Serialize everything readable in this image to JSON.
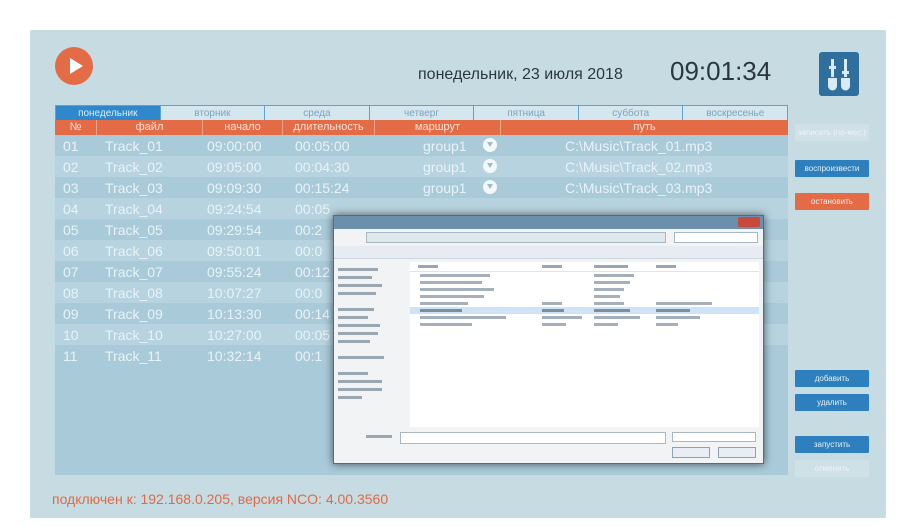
{
  "header": {
    "date": "понедельник, 23 июля 2018",
    "time": "09:01:34"
  },
  "tabs": [
    {
      "label": "понедельник",
      "active": true
    },
    {
      "label": "вторник",
      "active": false
    },
    {
      "label": "среда",
      "active": false
    },
    {
      "label": "четверг",
      "active": false
    },
    {
      "label": "пятница",
      "active": false
    },
    {
      "label": "суббота",
      "active": false
    },
    {
      "label": "воскресенье",
      "active": false
    }
  ],
  "table": {
    "columns": [
      "№",
      "файл",
      "начало",
      "длительность",
      "маршрут",
      "путь"
    ],
    "rows": [
      {
        "n": "01",
        "file": "Track_01",
        "start": "09:00:00",
        "dur": "00:05:00",
        "route": "group1",
        "path": "C:\\Music\\Track_01.mp3"
      },
      {
        "n": "02",
        "file": "Track_02",
        "start": "09:05:00",
        "dur": "00:04:30",
        "route": "group1",
        "path": "C:\\Music\\Track_02.mp3"
      },
      {
        "n": "03",
        "file": "Track_03",
        "start": "09:09:30",
        "dur": "00:15:24",
        "route": "group1",
        "path": "C:\\Music\\Track_03.mp3"
      },
      {
        "n": "04",
        "file": "Track_04",
        "start": "09:24:54",
        "dur": "00:05",
        "route": "",
        "path": ""
      },
      {
        "n": "05",
        "file": "Track_05",
        "start": "09:29:54",
        "dur": "00:2",
        "route": "",
        "path": ""
      },
      {
        "n": "06",
        "file": "Track_06",
        "start": "09:50:01",
        "dur": "00:0",
        "route": "",
        "path": ""
      },
      {
        "n": "07",
        "file": "Track_07",
        "start": "09:55:24",
        "dur": "00:12",
        "route": "",
        "path": ""
      },
      {
        "n": "08",
        "file": "Track_08",
        "start": "10:07:27",
        "dur": "00:0",
        "route": "",
        "path": ""
      },
      {
        "n": "09",
        "file": "Track_09",
        "start": "10:13:30",
        "dur": "00:14",
        "route": "",
        "path": ""
      },
      {
        "n": "10",
        "file": "Track_10",
        "start": "10:27:00",
        "dur": "00:05",
        "route": "",
        "path": ""
      },
      {
        "n": "11",
        "file": "Track_11",
        "start": "10:32:14",
        "dur": "00:1",
        "route": "",
        "path": ""
      }
    ]
  },
  "buttons": {
    "save": "записать (по-мес.)",
    "play": "воспроизвести",
    "stop": "остановить",
    "add": "добавить",
    "delete": "удалить",
    "run": "запустить",
    "cancel": "отменить"
  },
  "status": "подключен к: 192.168.0.205, версия NCO: 4.00.3560",
  "colors": {
    "accent": "#e36b45",
    "blue": "#2f88cc",
    "panel": "#c6dce2"
  },
  "icons": {
    "play": "play-icon",
    "eq": "equalizer-icon"
  }
}
